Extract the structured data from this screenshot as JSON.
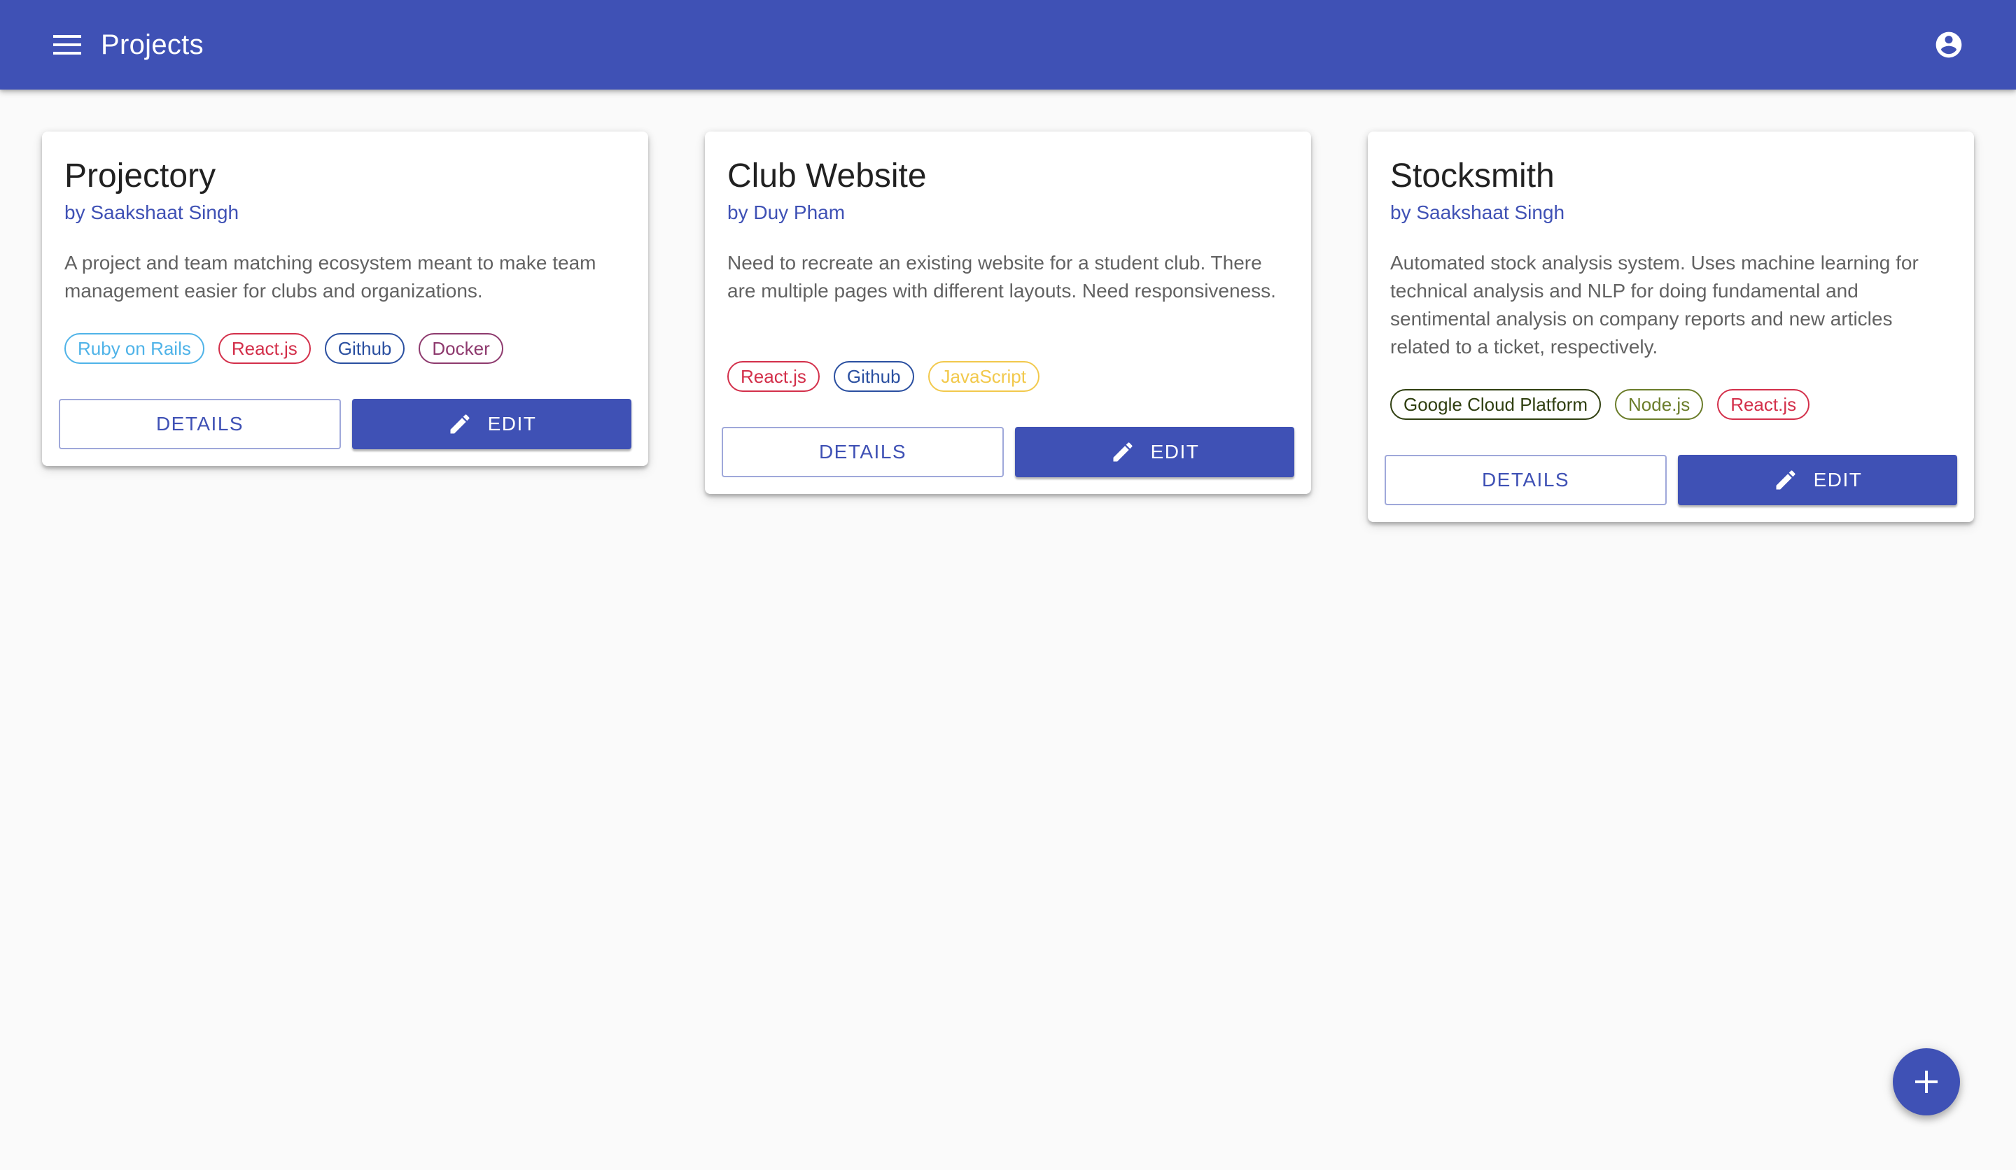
{
  "app": {
    "title": "Projects",
    "colors": {
      "primary": "#3f51b5",
      "background": "#fafafa"
    }
  },
  "appbar": {
    "menu_icon": "menu-icon",
    "account_icon": "account-circle-icon"
  },
  "projects": [
    {
      "title": "Projectory",
      "author": "by Saakshaat Singh",
      "description": "A project and team matching ecosystem meant to make team management easier for clubs and organizations.",
      "tags": [
        {
          "label": "Ruby on Rails",
          "color": "#4fb3e8"
        },
        {
          "label": "React.js",
          "color": "#d32f4a"
        },
        {
          "label": "Github",
          "color": "#2a4fa0"
        },
        {
          "label": "Docker",
          "color": "#8e3a6e"
        }
      ],
      "details_label": "DETAILS",
      "edit_label": "EDIT"
    },
    {
      "title": "Club Website",
      "author": "by Duy Pham",
      "description": "Need to recreate an existing website for a student club. There are multiple pages with different layouts. Need responsiveness.",
      "tags": [
        {
          "label": "React.js",
          "color": "#d32f4a"
        },
        {
          "label": "Github",
          "color": "#2a4fa0"
        },
        {
          "label": "JavaScript",
          "color": "#f2c94c"
        }
      ],
      "details_label": "DETAILS",
      "edit_label": "EDIT"
    },
    {
      "title": "Stocksmith",
      "author": "by Saakshaat Singh",
      "description": "Automated stock analysis system. Uses machine learning for technical analysis and NLP for doing fundamental and sentimental analysis on company reports and new articles related to a ticket, respectively.",
      "tags": [
        {
          "label": "Google Cloud Platform",
          "color": "#2f3f10"
        },
        {
          "label": "Node.js",
          "color": "#6b7d2a"
        },
        {
          "label": "React.js",
          "color": "#d32f4a"
        }
      ],
      "details_label": "DETAILS",
      "edit_label": "EDIT"
    }
  ],
  "fab": {
    "icon": "add-icon"
  }
}
